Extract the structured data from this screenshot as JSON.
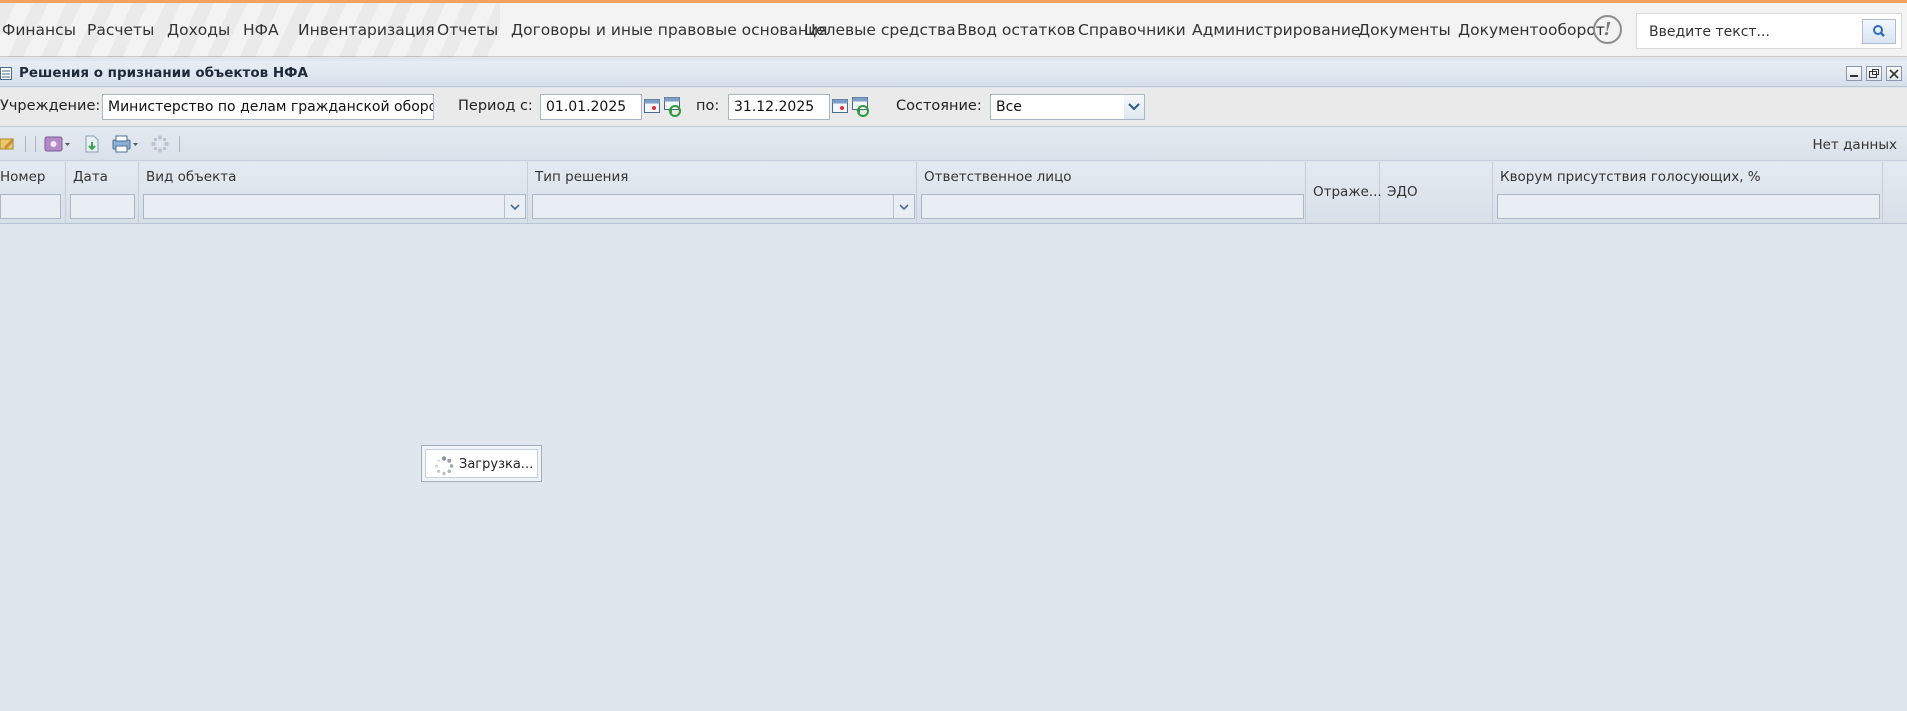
{
  "menu": {
    "items": [
      "Финансы",
      "Расчеты",
      "Доходы",
      "НФА",
      "Инвентаризация",
      "Отчеты",
      "Договоры и иные правовые основания",
      "Целевые средства",
      "Ввод остатков",
      "Справочники",
      "Администрирование",
      "Документы",
      "Документооборот"
    ],
    "help_symbol": "!",
    "search_placeholder": "Введите текст..."
  },
  "window": {
    "title": "Решения о признании объектов НФА"
  },
  "filters": {
    "institution_label": "Учреждение:",
    "institution_value": "Министерство по делам гражданской обороны",
    "period_from_label": "Период с:",
    "period_from_value": "01.01.2025",
    "period_to_label": "по:",
    "period_to_value": "31.12.2025",
    "state_label": "Состояние:",
    "state_value": "Все"
  },
  "toolbar": {
    "status_text": "Нет данных"
  },
  "grid": {
    "columns": [
      "Номер",
      "Дата",
      "Вид объекта",
      "Тип решения",
      "Ответственное лицо",
      "Отраже...",
      "ЭДО",
      "Кворум присутствия голосующих, %"
    ]
  },
  "loading": {
    "text": "Загрузка..."
  },
  "colors": {
    "accent_top": "#f2a35e",
    "background": "#dfe6ed"
  }
}
